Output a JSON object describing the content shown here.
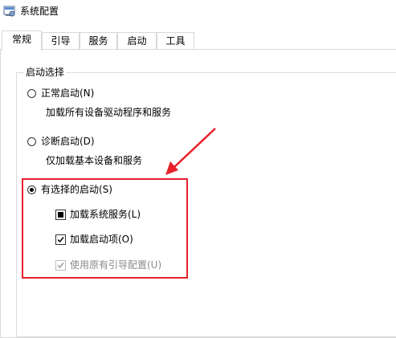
{
  "window": {
    "title": "系统配置",
    "icon": "system-config-app-icon"
  },
  "tabs": [
    {
      "label": "常规",
      "active": true
    },
    {
      "label": "引导",
      "active": false
    },
    {
      "label": "服务",
      "active": false
    },
    {
      "label": "启动",
      "active": false
    },
    {
      "label": "工具",
      "active": false
    }
  ],
  "startup_selection": {
    "group_label": "启动选择",
    "options": [
      {
        "label": "正常启动(N)",
        "description": "加载所有设备驱动程序和服务",
        "selected": false
      },
      {
        "label": "诊断启动(D)",
        "description": "仅加载基本设备和服务",
        "selected": false
      },
      {
        "label": "有选择的启动(S)",
        "description": "",
        "selected": true
      }
    ],
    "selective_items": [
      {
        "label": "加载系统服务(L)",
        "state": "indeterminate",
        "enabled": true
      },
      {
        "label": "加载启动项(O)",
        "state": "checked",
        "enabled": true
      },
      {
        "label": "使用原有引导配置(U)",
        "state": "checked",
        "enabled": false
      }
    ]
  },
  "annotations": {
    "color": "#e8202a"
  },
  "colors": {
    "border": "#d9d9d9",
    "disabled_text": "#8a8a8a",
    "accent_red": "#e8202a"
  }
}
